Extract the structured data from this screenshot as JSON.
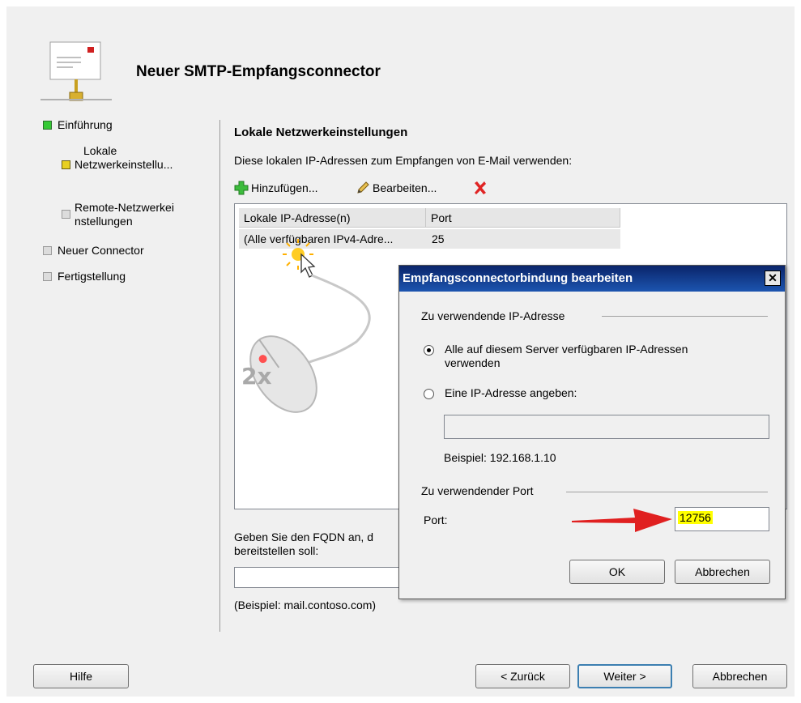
{
  "wizard": {
    "title": "Neuer SMTP-Empfangsconnector",
    "icon": "smtp-connector-icon"
  },
  "steps": [
    {
      "label": "Einführung",
      "state": "done",
      "color": "#35c935"
    },
    {
      "label_line1": "Lokale",
      "label_line2": "Netzwerkeinstellu...",
      "state": "current",
      "color": "#e8d020"
    },
    {
      "label_line1": "Remote-Netzwerkei",
      "label_line2": "nstellungen",
      "state": "pending"
    },
    {
      "label": "Neuer Connector",
      "state": "pending"
    },
    {
      "label": "Fertigstellung",
      "state": "pending"
    }
  ],
  "main": {
    "section_title": "Lokale Netzwerkeinstellungen",
    "description": "Diese lokalen IP-Adressen zum Empfangen von E-Mail verwenden:",
    "toolbar": {
      "add_label": "Hinzufügen...",
      "edit_label": "Bearbeiten...",
      "delete_icon": "red-x-delete-icon"
    },
    "list": {
      "columns": [
        "Lokale IP-Adresse(n)",
        "Port"
      ],
      "rows": [
        {
          "ip": "(Alle verfügbaren IPv4-Adre...",
          "port": "25"
        }
      ]
    },
    "overlay_label": "2x",
    "fqdn": {
      "text_line1": "Geben Sie den FQDN an, d",
      "text_line2": "bereitstellen soll:",
      "value": "",
      "example": "(Beispiel: mail.contoso.com)"
    }
  },
  "buttons": {
    "help": "Hilfe",
    "back": "< Zurück",
    "next": "Weiter >",
    "cancel": "Abbrechen"
  },
  "dialog": {
    "title": "Empfangsconnectorbindung bearbeiten",
    "close_glyph": "✕",
    "ip_group_label": "Zu verwendende IP-Adresse",
    "radio_all_line1": "Alle auf diesem Server verfügbaren IP-Adressen",
    "radio_all_line2": "verwenden",
    "radio_all_checked": true,
    "radio_specific": "Eine IP-Adresse angeben:",
    "ip_value": "",
    "example": "Beispiel: 192.168.1.10",
    "port_group_label": "Zu verwendender Port",
    "port_label": "Port:",
    "port_value": "12756",
    "highlight_color": "#ffff00",
    "arrow_color": "#e02020",
    "ok": "OK",
    "cancel": "Abbrechen"
  }
}
